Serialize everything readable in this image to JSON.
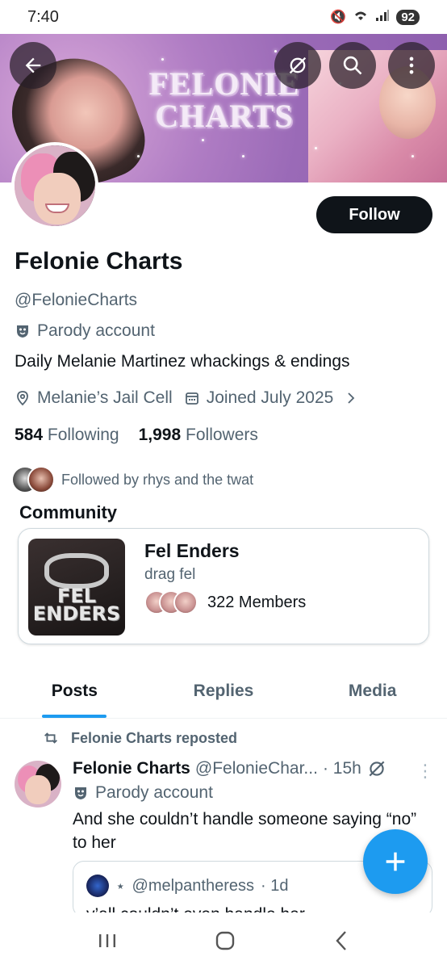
{
  "status_bar": {
    "time": "7:40",
    "battery": "92"
  },
  "banner": {
    "title_line1": "FELONIE",
    "title_line2": "CHARTS"
  },
  "profile": {
    "follow_label": "Follow",
    "name": "Felonie Charts",
    "handle": "@FelonieCharts",
    "parody_label": "Parody account",
    "bio": "Daily Melanie Martinez whackings & endings",
    "location": "Melanie’s Jail Cell",
    "joined": "Joined July 2025",
    "following_count": "584",
    "following_label": "Following",
    "followers_count": "1,998",
    "followers_label": "Followers",
    "followed_by": "Followed by rhys and the twat"
  },
  "community": {
    "section_title": "Community",
    "image_text_line1": "FEL",
    "image_text_line2": "ENDERS",
    "name": "Fel Enders",
    "subtitle": "drag fel",
    "members": "322 Members"
  },
  "tabs": [
    {
      "label": "Posts"
    },
    {
      "label": "Replies"
    },
    {
      "label": "Media"
    }
  ],
  "post": {
    "repost_label": "Felonie Charts reposted",
    "author_name": "Felonie Charts",
    "author_handle": "@FelonieChar...",
    "time": "· 15h",
    "parody_label": "Parody account",
    "text": "And she couldn’t handle someone saying “no” to her",
    "quote": {
      "handle": "@melpantheress",
      "time": "· 1d",
      "text": "y’all couldn’t even handle her"
    }
  },
  "colors": {
    "accent": "#1d9bf0",
    "text": "#0f1419",
    "secondary": "#536471"
  }
}
